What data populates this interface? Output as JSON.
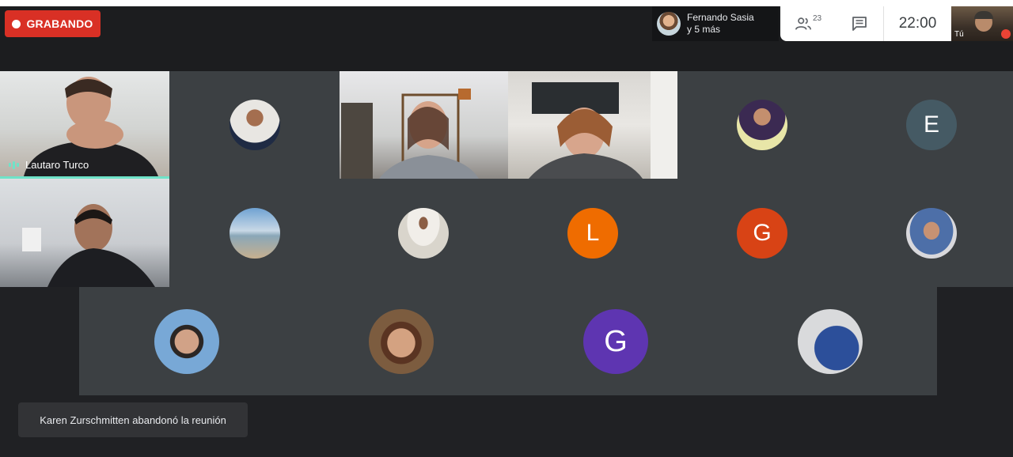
{
  "recording": {
    "label": "GRABANDO"
  },
  "presenter": {
    "name": "Fernando Sasia",
    "more": "y 5 más"
  },
  "toolbar": {
    "people_count": "23",
    "clock": "22:00",
    "people_icon": "people-icon",
    "chat_icon": "chat-icon"
  },
  "self_view": {
    "label": "Tú",
    "mic_status": "muted"
  },
  "participants": {
    "lautaro": {
      "name": "Lautaro Turco",
      "speaking": true
    },
    "e_initial": {
      "letter": "E",
      "color": "#455a64"
    },
    "l_initial": {
      "letter": "L",
      "color": "#ef6c00"
    },
    "g1_initial": {
      "letter": "G",
      "color": "#d84315"
    },
    "g2_initial": {
      "letter": "G",
      "color": "#5e35b1"
    }
  },
  "notification": {
    "text": "Karen Zurschmitten abandonó la reunión"
  }
}
